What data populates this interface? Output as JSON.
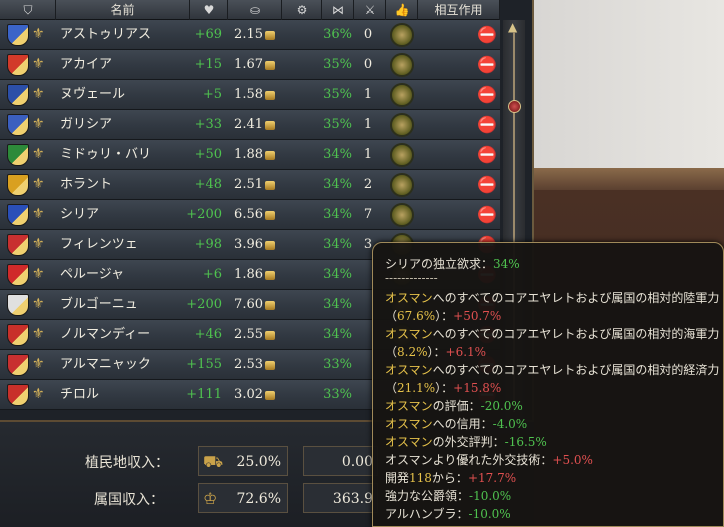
{
  "header": {
    "name_label": "名前",
    "interaction_label": "相互作用"
  },
  "icons": {
    "shield": "shield-icon",
    "heart": "heart-icon",
    "coins": "coins-icon",
    "forces": "forces-icon",
    "ratio": "ratio-icon",
    "swords": "swords-icon",
    "thumb": "thumb-icon"
  },
  "subjects": [
    {
      "name": "アストゥリアス",
      "liberty": "+69",
      "income": "2.15",
      "share": "36%",
      "count": "0",
      "flag": "#3b64c8"
    },
    {
      "name": "アカイア",
      "liberty": "+15",
      "income": "1.67",
      "share": "35%",
      "count": "0",
      "flag": "#d23a2a"
    },
    {
      "name": "ヌヴェール",
      "liberty": "+5",
      "income": "1.58",
      "share": "35%",
      "count": "1",
      "flag": "#2c4fa8"
    },
    {
      "name": "ガリシア",
      "liberty": "+33",
      "income": "2.41",
      "share": "35%",
      "count": "1",
      "flag": "#3b5fbf"
    },
    {
      "name": "ミドゥリ・バリ",
      "liberty": "+50",
      "income": "1.88",
      "share": "34%",
      "count": "1",
      "flag": "#2d8a3a"
    },
    {
      "name": "ホラント",
      "liberty": "+48",
      "income": "2.51",
      "share": "34%",
      "count": "2",
      "flag": "#d9a020"
    },
    {
      "name": "シリア",
      "liberty": "+200",
      "income": "6.56",
      "share": "34%",
      "count": "7",
      "flag": "#2a4fb8"
    },
    {
      "name": "フィレンツェ",
      "liberty": "+98",
      "income": "3.96",
      "share": "34%",
      "count": "3",
      "flag": "#c83030"
    },
    {
      "name": "ペルージャ",
      "liberty": "+6",
      "income": "1.86",
      "share": "34%",
      "count": "",
      "flag": "#d02a2a"
    },
    {
      "name": "ブルゴーニュ",
      "liberty": "+200",
      "income": "7.60",
      "share": "34%",
      "count": "",
      "flag": "#e0e0e0"
    },
    {
      "name": "ノルマンディー",
      "liberty": "+46",
      "income": "2.55",
      "share": "34%",
      "count": "",
      "flag": "#c8302a"
    },
    {
      "name": "アルマニャック",
      "liberty": "+155",
      "income": "2.53",
      "share": "33%",
      "count": "",
      "flag": "#c83030"
    },
    {
      "name": "チロル",
      "liberty": "+111",
      "income": "3.02",
      "share": "33%",
      "count": "",
      "flag": "#c8302a"
    }
  ],
  "bottom": {
    "colonial_label": "植民地収入：",
    "colonial_pct": "25.0%",
    "colonial_value": "0.00",
    "subject_label": "属国収入：",
    "subject_pct": "72.6%",
    "subject_value": "363.9"
  },
  "tooltip": {
    "title": "シリアの独立欲求：",
    "title_value": "34%",
    "sep": "-------------",
    "line1_owner": "オスマン",
    "line1_text": "へのすべてのコアエヤレトおよび属国の相対的陸軍力",
    "line1_pct": "67.6%",
    "line1_val": "+50.7%",
    "line2_owner": "オスマン",
    "line2_text": "へのすべてのコアエヤレトおよび属国の相対的海軍力",
    "line2_pct": "8.2%",
    "line2_val": "+6.1%",
    "line3_owner": "オスマン",
    "line3_text": "へのすべてのコアエヤレトおよび属国の相対的経済力",
    "line3_pct": "21.1%",
    "line3_val": "+15.8%",
    "l4_owner": "オスマン",
    "l4_text": "の評価：",
    "l4_val": "-20.0%",
    "l5_owner": "オスマン",
    "l5_text": "への信用：",
    "l5_val": "-4.0%",
    "l6_owner": "オスマン",
    "l6_text": "の外交評判：",
    "l6_val": "-16.5%",
    "l7_text": "オスマンより優れた外交技術：",
    "l7_val": "+5.0%",
    "l8_text1": "開発",
    "l8_num": "118",
    "l8_text2": "から：",
    "l8_val": "+17.7%",
    "l9_text": "強力な公爵領：",
    "l9_val": "-10.0%",
    "l10_text": "アルハンブラ：",
    "l10_val": "-10.0%"
  }
}
